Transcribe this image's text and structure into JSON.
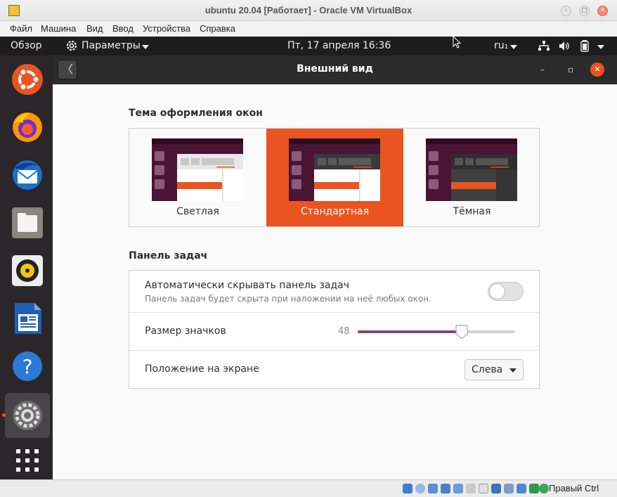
{
  "window": {
    "title": "ubuntu 20.04 [Работает] - Oracle VM VirtualBox"
  },
  "vb_menu": [
    "Файл",
    "Машина",
    "Вид",
    "Ввод",
    "Устройства",
    "Справка"
  ],
  "topbar": {
    "overview": "Обзор",
    "app_menu": "Параметры",
    "clock": "Пт, 17 апреля  16:36",
    "keyboard": "ru₁"
  },
  "dock": {
    "icons": [
      "ubuntu-software-icon",
      "firefox-icon",
      "thunderbird-icon",
      "files-icon",
      "rhythmbox-icon",
      "libreoffice-writer-icon",
      "help-icon",
      "settings-icon",
      "show-apps-icon"
    ],
    "active_index": 7
  },
  "settings": {
    "header_title": "Внешний вид",
    "window_theme_title": "Тема оформления окон",
    "themes": [
      "Светлая",
      "Стандартная",
      "Тёмная"
    ],
    "selected_theme": "Стандартная",
    "dock_section_title": "Панель задач",
    "autohide": {
      "label": "Автоматически скрывать панель задач",
      "sublabel": "Панель задач будет скрыта при наложении на неё любых окон.",
      "enabled": false
    },
    "icon_size": {
      "label": "Размер значков",
      "value": "48",
      "fraction": 0.66
    },
    "position": {
      "label": "Положение на экране",
      "value": "Слева"
    }
  },
  "statusbar": {
    "host_key": "Правый Ctrl"
  },
  "colors": {
    "accent": "#e95420",
    "slider": "#7b4a7e",
    "dock": "#2a2629",
    "headerbar": "#2b2b2b"
  }
}
